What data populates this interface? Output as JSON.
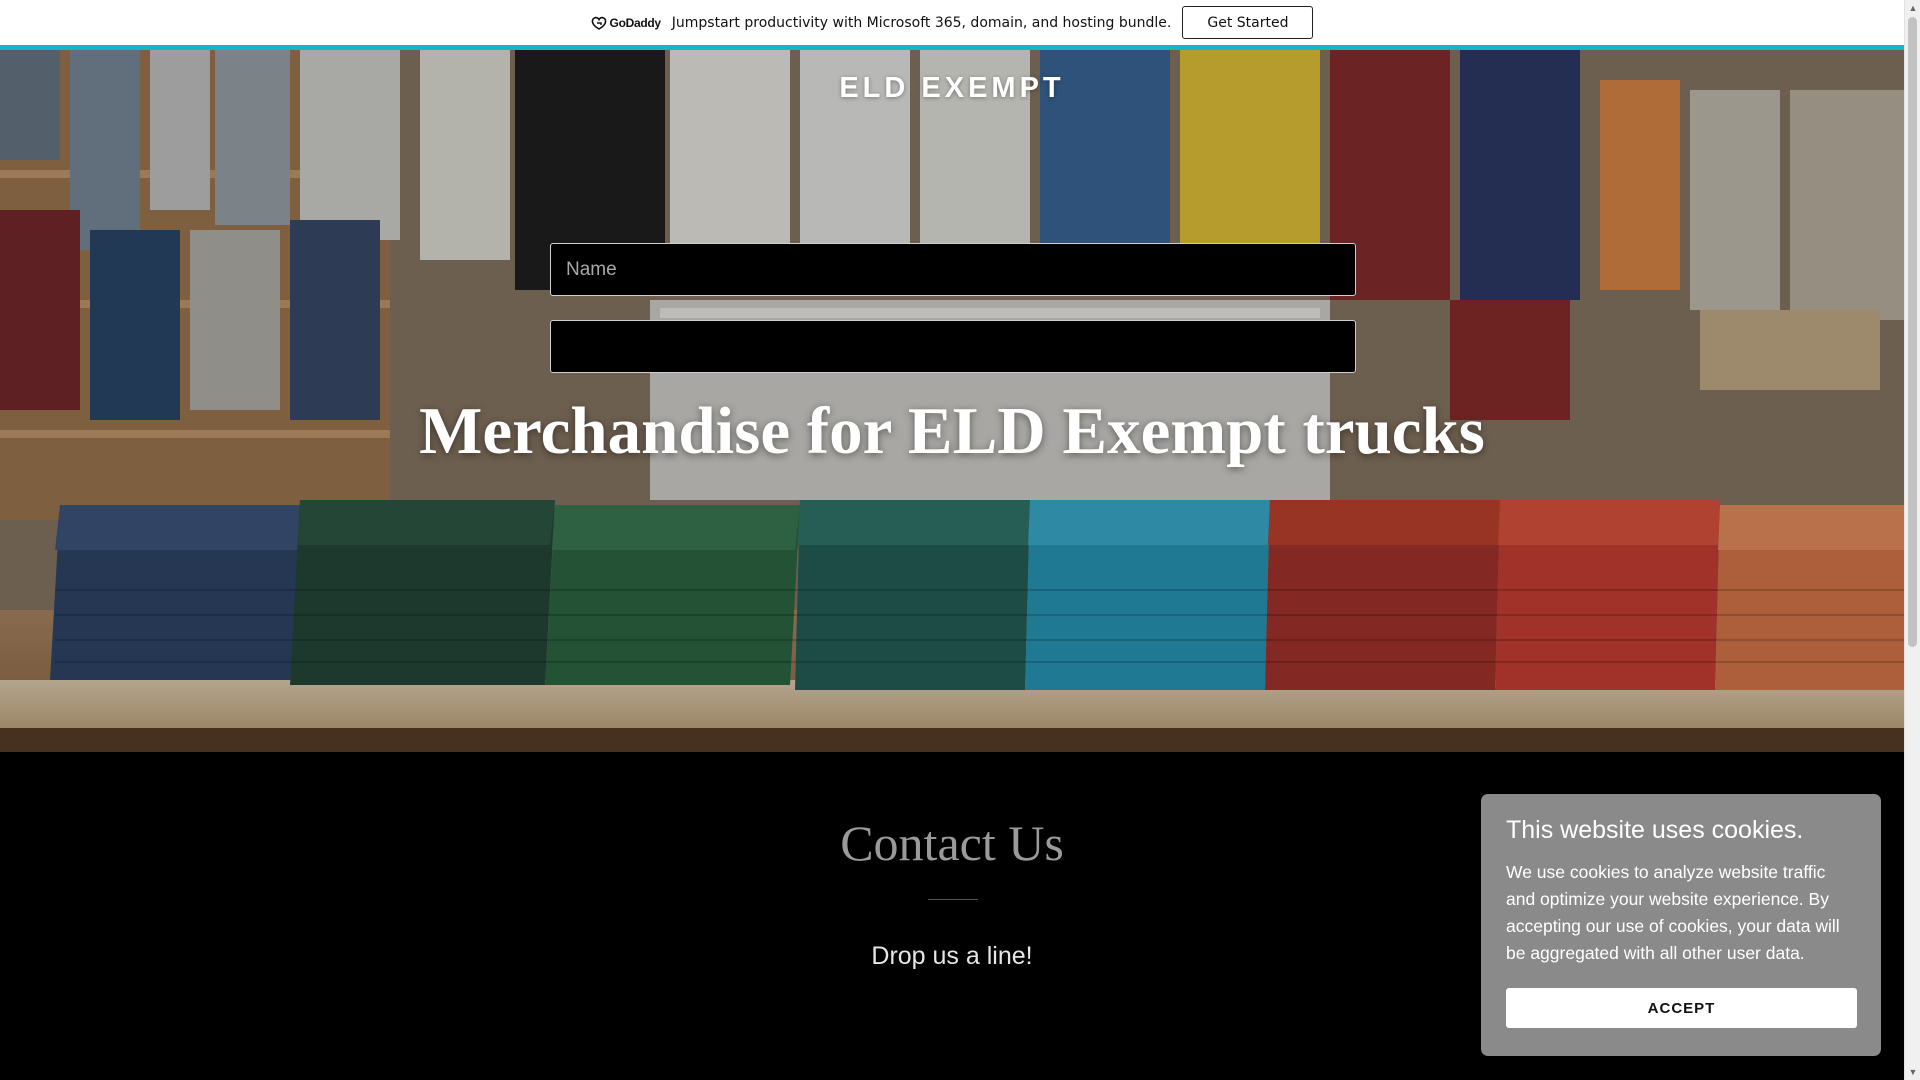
{
  "promo": {
    "brand": "GoDaddy",
    "text": "Jumpstart productivity with Microsoft 365, domain, and hosting bundle.",
    "cta_label": "Get Started"
  },
  "hero": {
    "site_title": "ELD EXEMPT",
    "heading": "Merchandise for ELD Exempt trucks"
  },
  "contact": {
    "title": "Contact Us",
    "subtitle": "Drop us a line!",
    "name_placeholder": "Name",
    "email_placeholder": ""
  },
  "cookie": {
    "title": "This website uses cookies.",
    "body": "We use cookies to analyze website traffic and optimize your website experience. By accepting our use of cookies, your data will be aggregated with all other user data.",
    "accept_label": "ACCEPT"
  },
  "colors": {
    "promo_accent": "#1bb4c1",
    "cookie_bg": "#8a8a8a",
    "page_bg": "#000000"
  },
  "icons": {
    "brand_logo": "godaddy-logo-icon",
    "scroll_up": "scroll-up-arrow-icon",
    "scroll_down": "scroll-down-arrow-icon"
  }
}
